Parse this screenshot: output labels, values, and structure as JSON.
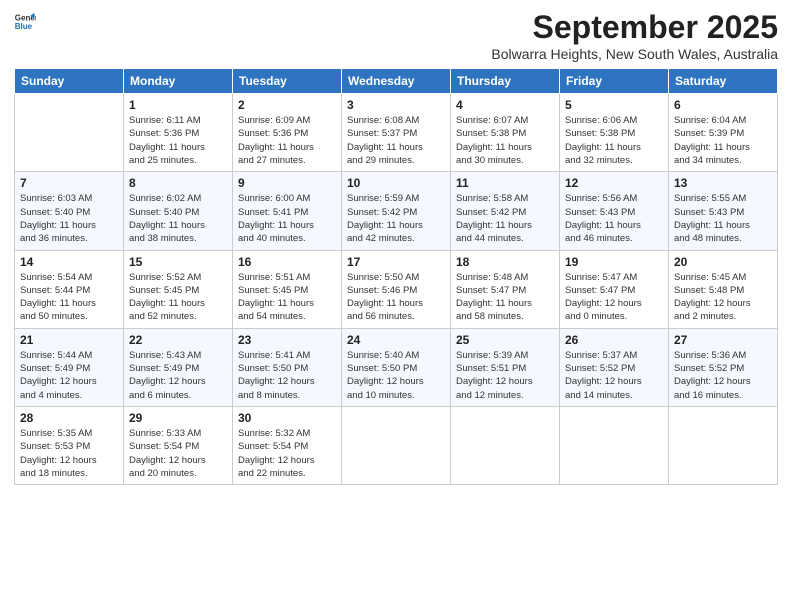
{
  "logo": {
    "line1": "General",
    "line2": "Blue"
  },
  "title": "September 2025",
  "subtitle": "Bolwarra Heights, New South Wales, Australia",
  "weekdays": [
    "Sunday",
    "Monday",
    "Tuesday",
    "Wednesday",
    "Thursday",
    "Friday",
    "Saturday"
  ],
  "weeks": [
    [
      {
        "day": "",
        "info": ""
      },
      {
        "day": "1",
        "info": "Sunrise: 6:11 AM\nSunset: 5:36 PM\nDaylight: 11 hours\nand 25 minutes."
      },
      {
        "day": "2",
        "info": "Sunrise: 6:09 AM\nSunset: 5:36 PM\nDaylight: 11 hours\nand 27 minutes."
      },
      {
        "day": "3",
        "info": "Sunrise: 6:08 AM\nSunset: 5:37 PM\nDaylight: 11 hours\nand 29 minutes."
      },
      {
        "day": "4",
        "info": "Sunrise: 6:07 AM\nSunset: 5:38 PM\nDaylight: 11 hours\nand 30 minutes."
      },
      {
        "day": "5",
        "info": "Sunrise: 6:06 AM\nSunset: 5:38 PM\nDaylight: 11 hours\nand 32 minutes."
      },
      {
        "day": "6",
        "info": "Sunrise: 6:04 AM\nSunset: 5:39 PM\nDaylight: 11 hours\nand 34 minutes."
      }
    ],
    [
      {
        "day": "7",
        "info": "Sunrise: 6:03 AM\nSunset: 5:40 PM\nDaylight: 11 hours\nand 36 minutes."
      },
      {
        "day": "8",
        "info": "Sunrise: 6:02 AM\nSunset: 5:40 PM\nDaylight: 11 hours\nand 38 minutes."
      },
      {
        "day": "9",
        "info": "Sunrise: 6:00 AM\nSunset: 5:41 PM\nDaylight: 11 hours\nand 40 minutes."
      },
      {
        "day": "10",
        "info": "Sunrise: 5:59 AM\nSunset: 5:42 PM\nDaylight: 11 hours\nand 42 minutes."
      },
      {
        "day": "11",
        "info": "Sunrise: 5:58 AM\nSunset: 5:42 PM\nDaylight: 11 hours\nand 44 minutes."
      },
      {
        "day": "12",
        "info": "Sunrise: 5:56 AM\nSunset: 5:43 PM\nDaylight: 11 hours\nand 46 minutes."
      },
      {
        "day": "13",
        "info": "Sunrise: 5:55 AM\nSunset: 5:43 PM\nDaylight: 11 hours\nand 48 minutes."
      }
    ],
    [
      {
        "day": "14",
        "info": "Sunrise: 5:54 AM\nSunset: 5:44 PM\nDaylight: 11 hours\nand 50 minutes."
      },
      {
        "day": "15",
        "info": "Sunrise: 5:52 AM\nSunset: 5:45 PM\nDaylight: 11 hours\nand 52 minutes."
      },
      {
        "day": "16",
        "info": "Sunrise: 5:51 AM\nSunset: 5:45 PM\nDaylight: 11 hours\nand 54 minutes."
      },
      {
        "day": "17",
        "info": "Sunrise: 5:50 AM\nSunset: 5:46 PM\nDaylight: 11 hours\nand 56 minutes."
      },
      {
        "day": "18",
        "info": "Sunrise: 5:48 AM\nSunset: 5:47 PM\nDaylight: 11 hours\nand 58 minutes."
      },
      {
        "day": "19",
        "info": "Sunrise: 5:47 AM\nSunset: 5:47 PM\nDaylight: 12 hours\nand 0 minutes."
      },
      {
        "day": "20",
        "info": "Sunrise: 5:45 AM\nSunset: 5:48 PM\nDaylight: 12 hours\nand 2 minutes."
      }
    ],
    [
      {
        "day": "21",
        "info": "Sunrise: 5:44 AM\nSunset: 5:49 PM\nDaylight: 12 hours\nand 4 minutes."
      },
      {
        "day": "22",
        "info": "Sunrise: 5:43 AM\nSunset: 5:49 PM\nDaylight: 12 hours\nand 6 minutes."
      },
      {
        "day": "23",
        "info": "Sunrise: 5:41 AM\nSunset: 5:50 PM\nDaylight: 12 hours\nand 8 minutes."
      },
      {
        "day": "24",
        "info": "Sunrise: 5:40 AM\nSunset: 5:50 PM\nDaylight: 12 hours\nand 10 minutes."
      },
      {
        "day": "25",
        "info": "Sunrise: 5:39 AM\nSunset: 5:51 PM\nDaylight: 12 hours\nand 12 minutes."
      },
      {
        "day": "26",
        "info": "Sunrise: 5:37 AM\nSunset: 5:52 PM\nDaylight: 12 hours\nand 14 minutes."
      },
      {
        "day": "27",
        "info": "Sunrise: 5:36 AM\nSunset: 5:52 PM\nDaylight: 12 hours\nand 16 minutes."
      }
    ],
    [
      {
        "day": "28",
        "info": "Sunrise: 5:35 AM\nSunset: 5:53 PM\nDaylight: 12 hours\nand 18 minutes."
      },
      {
        "day": "29",
        "info": "Sunrise: 5:33 AM\nSunset: 5:54 PM\nDaylight: 12 hours\nand 20 minutes."
      },
      {
        "day": "30",
        "info": "Sunrise: 5:32 AM\nSunset: 5:54 PM\nDaylight: 12 hours\nand 22 minutes."
      },
      {
        "day": "",
        "info": ""
      },
      {
        "day": "",
        "info": ""
      },
      {
        "day": "",
        "info": ""
      },
      {
        "day": "",
        "info": ""
      }
    ]
  ]
}
